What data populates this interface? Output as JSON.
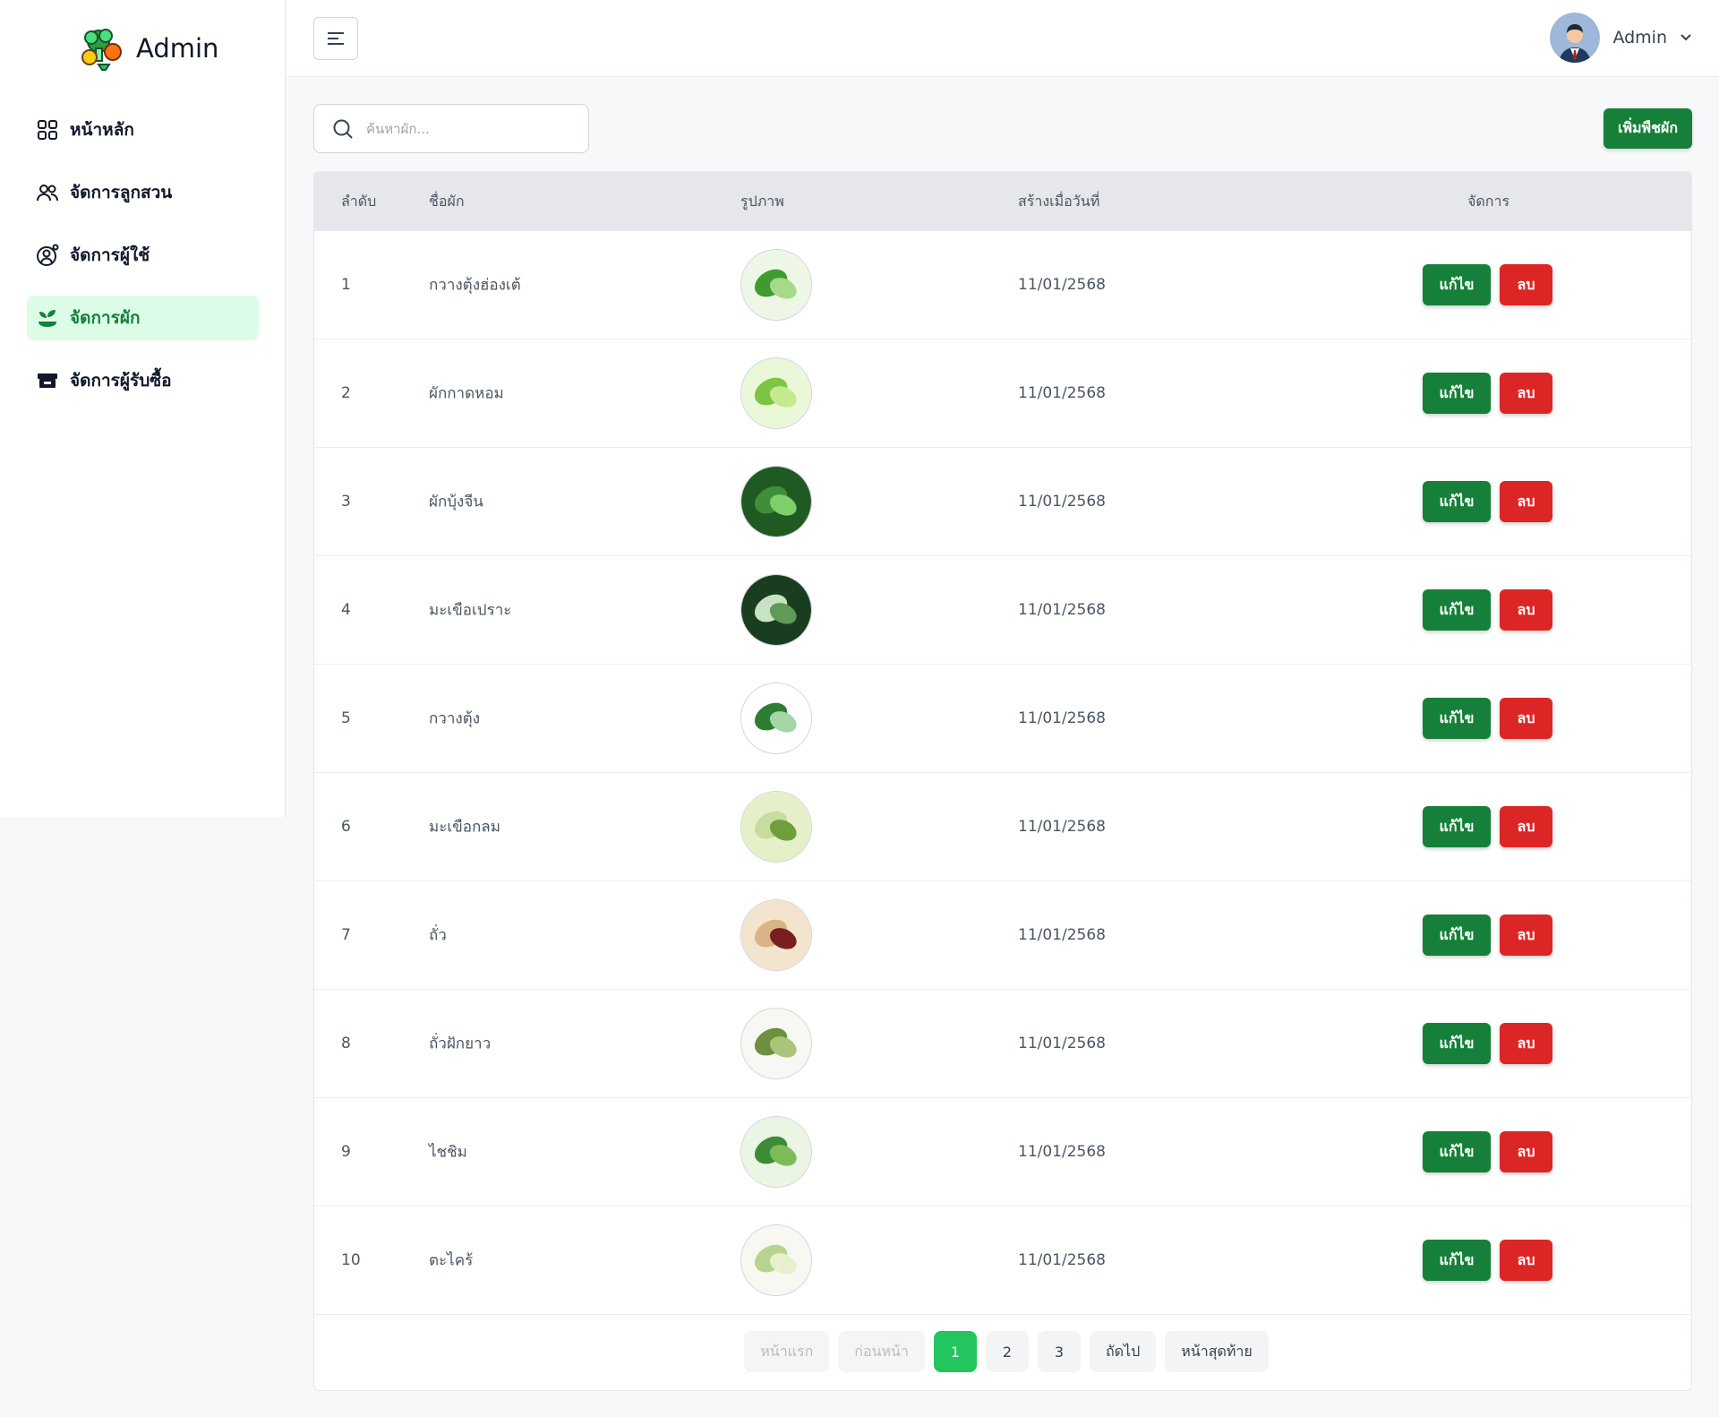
{
  "brand": {
    "title": "Admin"
  },
  "sidebar": {
    "items": [
      {
        "label": "หน้าหลัก",
        "icon": "dashboard-grid-icon",
        "active": false
      },
      {
        "label": "จัดการลูกสวน",
        "icon": "users-icon",
        "active": false
      },
      {
        "label": "จัดการผู้ใช้",
        "icon": "user-settings-icon",
        "active": false
      },
      {
        "label": "จัดการผัก",
        "icon": "sprout-icon",
        "active": true
      },
      {
        "label": "จัดการผู้รับซื้อ",
        "icon": "store-icon",
        "active": false
      }
    ]
  },
  "header": {
    "user_name": "Admin",
    "menu_icon": "menu-toggle-icon",
    "dropdown_icon": "chevron-down-icon"
  },
  "search": {
    "placeholder": "ค้นหาผัก...",
    "value": ""
  },
  "toolbar": {
    "add_label": "เพิ่มพืชผัก"
  },
  "table": {
    "columns": {
      "no": "ลำดับ",
      "name": "ชื่อผัก",
      "image": "รูปภาพ",
      "created": "สร้างเมื่อวันที่",
      "actions": "จัดการ"
    },
    "edit_label": "แก้ไข",
    "delete_label": "ลบ",
    "rows": [
      {
        "no": "1",
        "name": "กวางตุ้งฮ่องเต้",
        "created": "11/01/2568",
        "thumb": "bok-choy"
      },
      {
        "no": "2",
        "name": "ผักกาดหอม",
        "created": "11/01/2568",
        "thumb": "lettuce"
      },
      {
        "no": "3",
        "name": "ผักบุ้งจีน",
        "created": "11/01/2568",
        "thumb": "morning-glory"
      },
      {
        "no": "4",
        "name": "มะเขือเปราะ",
        "created": "11/01/2568",
        "thumb": "thai-eggplant"
      },
      {
        "no": "5",
        "name": "กวางตุ้ง",
        "created": "11/01/2568",
        "thumb": "choy-sum"
      },
      {
        "no": "6",
        "name": "มะเขือกลม",
        "created": "11/01/2568",
        "thumb": "round-eggplant"
      },
      {
        "no": "7",
        "name": "ถั่ว",
        "created": "11/01/2568",
        "thumb": "peanut"
      },
      {
        "no": "8",
        "name": "ถั่วฝักยาว",
        "created": "11/01/2568",
        "thumb": "long-bean"
      },
      {
        "no": "9",
        "name": "ไชชิม",
        "created": "11/01/2568",
        "thumb": "chinese-cabbage"
      },
      {
        "no": "10",
        "name": "ตะไคร้",
        "created": "11/01/2568",
        "thumb": "lemongrass"
      }
    ]
  },
  "pagination": {
    "first": "หน้าแรก",
    "prev": "ก่อนหน้า",
    "pages": [
      "1",
      "2",
      "3"
    ],
    "current": "1",
    "next": "ถัดไป",
    "last": "หน้าสุดท้าย"
  },
  "colors": {
    "accent": "#16803a",
    "danger": "#dc2626",
    "active_page": "#22c55e",
    "active_nav_bg": "#dcfce7"
  }
}
